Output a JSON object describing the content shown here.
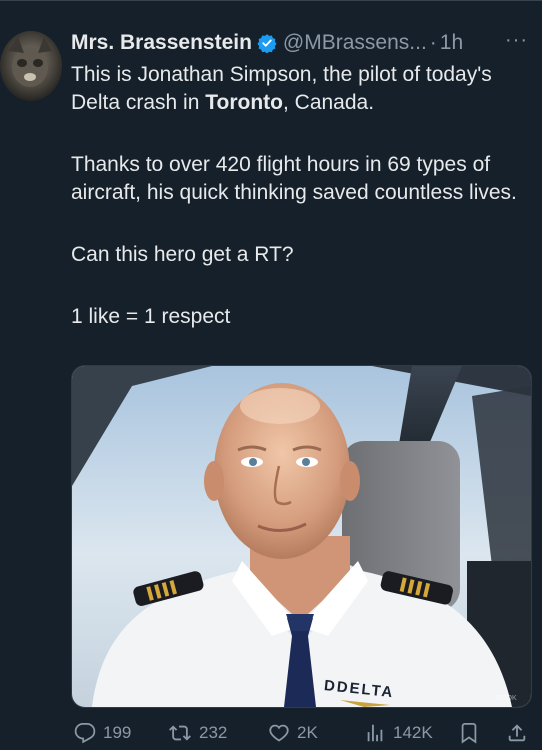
{
  "tweet": {
    "author_name": "Mrs. Brassenstein",
    "handle": "@MBrassens...",
    "separator": "·",
    "time": "1h",
    "more_label": "···",
    "verified": true,
    "paragraphs": {
      "p1a": "This is Jonathan Simpson, the pilot of today's Delta crash in ",
      "p1b": "Toronto",
      "p1c": ", Canada.",
      "p2": "Thanks to over 420 flight hours in 69 types of aircraft, his quick thinking saved countless lives.",
      "p3": "Can this hero get a RT?",
      "p4": "1 like = 1 respect"
    },
    "image": {
      "epaulette_text": "DDELTA",
      "watermark": "GROK"
    }
  },
  "actions": {
    "replies": "199",
    "reposts": "232",
    "likes": "2K",
    "views": "142K"
  },
  "colors": {
    "background": "#15202b",
    "text": "#e7e9ea",
    "secondary": "#8b98a5",
    "verified_blue": "#1d9bf0"
  }
}
